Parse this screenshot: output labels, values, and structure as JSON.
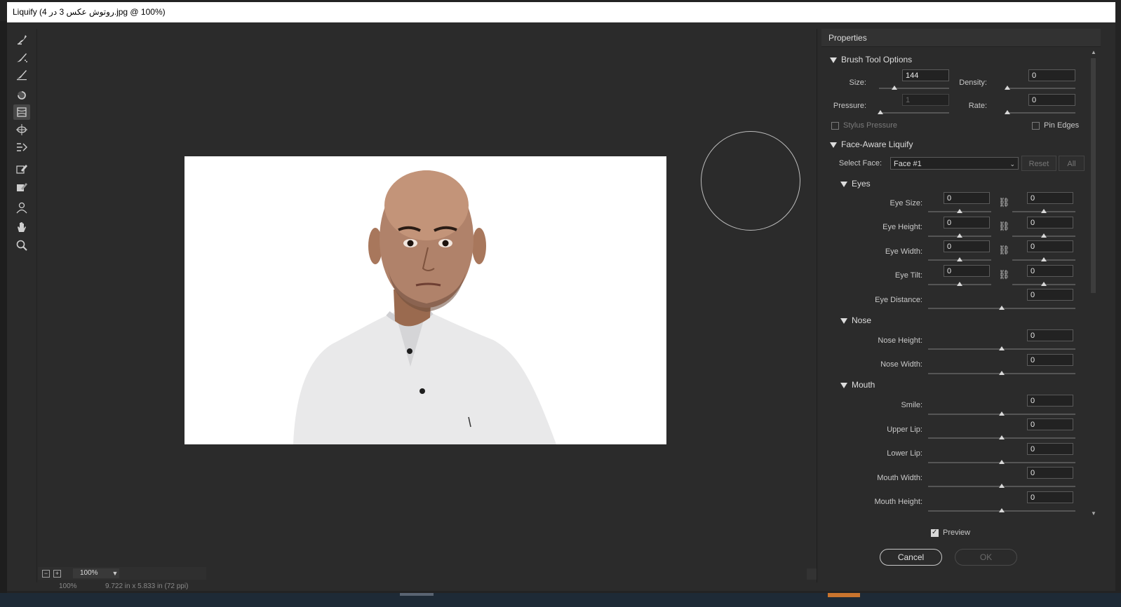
{
  "window": {
    "title": "Liquify (4 روتوش عکس 3 در.jpg @ 100%)"
  },
  "tools": [
    {
      "name": "forward-warp-tool",
      "active": false
    },
    {
      "name": "reconstruct-tool",
      "active": false
    },
    {
      "name": "smooth-tool",
      "active": false
    },
    {
      "name": "twirl-tool",
      "active": false
    },
    {
      "name": "pucker-tool",
      "active": true
    },
    {
      "name": "bloat-tool",
      "active": false
    },
    {
      "name": "push-left-tool",
      "active": false
    },
    {
      "name": "freeze-mask-tool",
      "active": false
    },
    {
      "name": "thaw-mask-tool",
      "active": false
    },
    {
      "name": "face-tool",
      "active": false
    },
    {
      "name": "hand-tool",
      "active": false
    },
    {
      "name": "zoom-tool",
      "active": false
    }
  ],
  "zoom": {
    "value": "100%"
  },
  "status": {
    "zoom": "100%",
    "doc_info": "9.722 in x 5.833 in (72 ppi)"
  },
  "properties": {
    "title": "Properties",
    "brush": {
      "section": "Brush Tool Options",
      "size_label": "Size:",
      "size_value": "144",
      "size_level": 0.22,
      "density_label": "Density:",
      "density_value": "0",
      "density_level": 0.0,
      "pressure_label": "Pressure:",
      "pressure_value": "1",
      "pressure_level": 0.01,
      "rate_label": "Rate:",
      "rate_value": "0",
      "rate_level": 0.0,
      "stylus_label": "Stylus Pressure",
      "stylus_checked": false,
      "pin_label": "Pin Edges",
      "pin_checked": false
    },
    "face": {
      "section": "Face-Aware Liquify",
      "select_label": "Select Face:",
      "select_value": "Face #1",
      "reset_label": "Reset",
      "all_label": "All",
      "eyes": {
        "section": "Eyes",
        "rows": [
          {
            "label": "Eye Size:",
            "left": "0",
            "right": "0"
          },
          {
            "label": "Eye Height:",
            "left": "0",
            "right": "0"
          },
          {
            "label": "Eye Width:",
            "left": "0",
            "right": "0"
          },
          {
            "label": "Eye Tilt:",
            "left": "0",
            "right": "0"
          }
        ],
        "distance_label": "Eye Distance:",
        "distance_value": "0"
      },
      "nose": {
        "section": "Nose",
        "rows": [
          {
            "label": "Nose Height:",
            "value": "0"
          },
          {
            "label": "Nose Width:",
            "value": "0"
          }
        ]
      },
      "mouth": {
        "section": "Mouth",
        "rows": [
          {
            "label": "Smile:",
            "value": "0"
          },
          {
            "label": "Upper Lip:",
            "value": "0"
          },
          {
            "label": "Lower Lip:",
            "value": "0"
          },
          {
            "label": "Mouth Width:",
            "value": "0"
          },
          {
            "label": "Mouth Height:",
            "value": "0"
          }
        ]
      }
    }
  },
  "footer": {
    "preview_label": "Preview",
    "preview_checked": true,
    "cancel_label": "Cancel",
    "ok_label": "OK"
  },
  "colors": {
    "panel_bg": "#2b2b2b",
    "dialog_bg": "#2b2b2b",
    "title_bg": "#ffffff",
    "accent": "#c8742e"
  }
}
